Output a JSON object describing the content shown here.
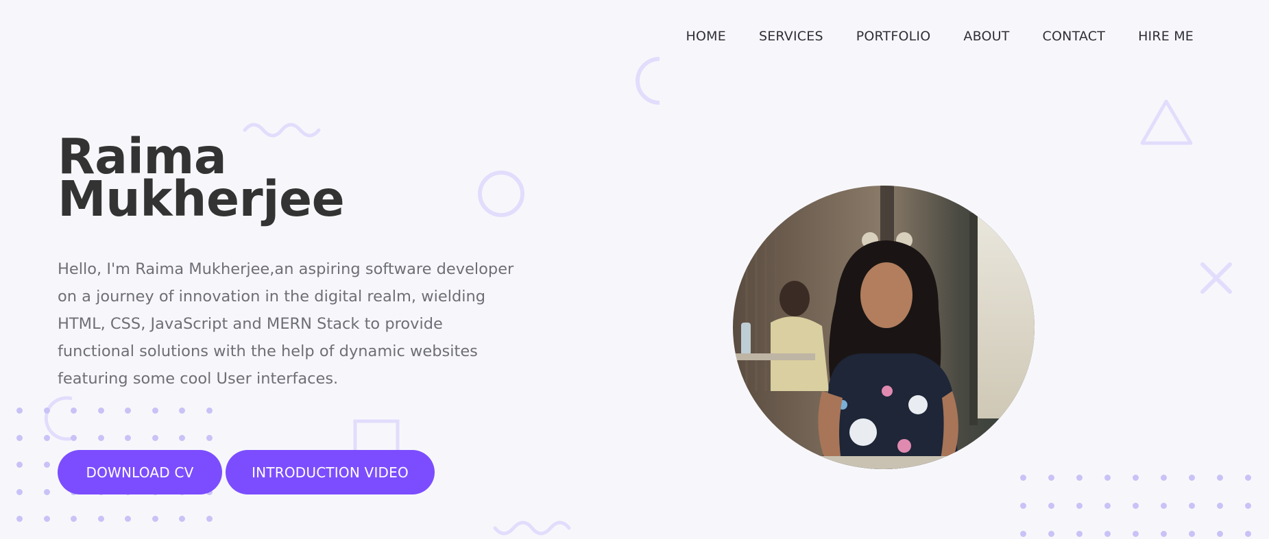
{
  "nav": {
    "items": [
      {
        "label": "HOME",
        "name": "nav-home"
      },
      {
        "label": "SERVICES",
        "name": "nav-services"
      },
      {
        "label": "PORTFOLIO",
        "name": "nav-portfolio"
      },
      {
        "label": "ABOUT",
        "name": "nav-about"
      },
      {
        "label": "CONTACT",
        "name": "nav-contact"
      },
      {
        "label": "HIRE ME",
        "name": "nav-hire-me"
      }
    ]
  },
  "hero": {
    "first_name": "Raima",
    "last_name": "Mukherjee",
    "description": "Hello, I'm Raima Mukherjee,an aspiring software developer on a journey of innovation in the digital realm, wielding HTML, CSS, JavaScript and MERN Stack to provide functional solutions with the help of dynamic websites featuring some cool User interfaces.",
    "download_cv_label": "DOWNLOAD CV",
    "intro_video_label": "INTRODUCTION VIDEO"
  },
  "colors": {
    "accent": "#7c4dff",
    "background": "#f7f7fb",
    "decoration": "#e2ddfc",
    "heading": "#333333",
    "body_text": "#6e6e76"
  }
}
